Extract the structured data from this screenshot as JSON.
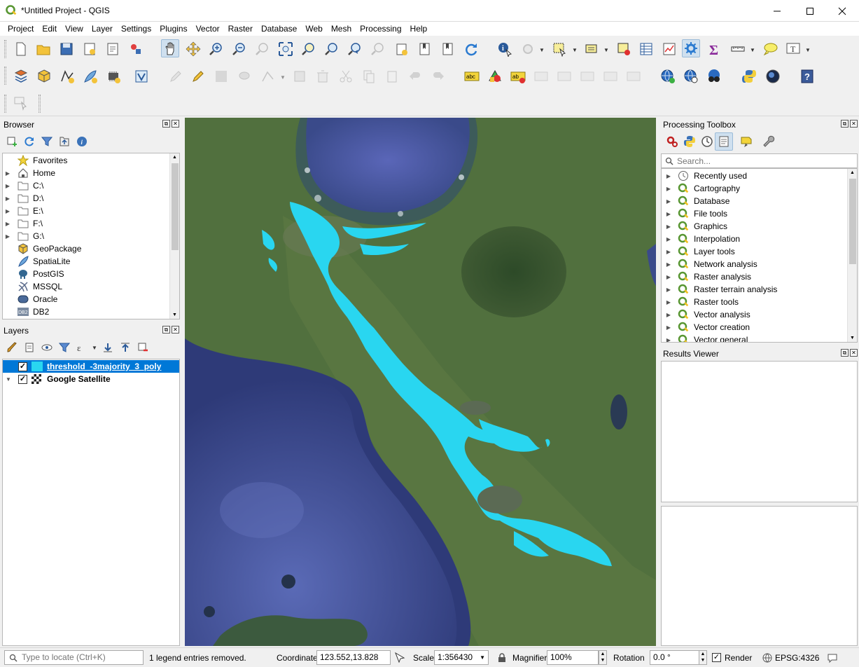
{
  "window": {
    "title": "*Untitled Project - QGIS",
    "controls": [
      "—",
      "☐",
      "✕"
    ]
  },
  "menubar": {
    "items": [
      "Project",
      "Edit",
      "View",
      "Layer",
      "Settings",
      "Plugins",
      "Vector",
      "Raster",
      "Database",
      "Web",
      "Mesh",
      "Processing",
      "Help"
    ]
  },
  "browser": {
    "title": "Browser",
    "items": [
      {
        "label": "Favorites",
        "icon": "star-icon",
        "expandable": false
      },
      {
        "label": "Home",
        "icon": "home-icon",
        "expandable": true
      },
      {
        "label": "C:\\",
        "icon": "folder-icon",
        "expandable": true
      },
      {
        "label": "D:\\",
        "icon": "folder-icon",
        "expandable": true
      },
      {
        "label": "E:\\",
        "icon": "folder-icon",
        "expandable": true
      },
      {
        "label": "F:\\",
        "icon": "folder-icon",
        "expandable": true
      },
      {
        "label": "G:\\",
        "icon": "folder-icon",
        "expandable": true
      },
      {
        "label": "GeoPackage",
        "icon": "geopackage-icon",
        "expandable": false
      },
      {
        "label": "SpatiaLite",
        "icon": "feather-icon",
        "expandable": false
      },
      {
        "label": "PostGIS",
        "icon": "elephant-icon",
        "expandable": false
      },
      {
        "label": "MSSQL",
        "icon": "mssql-icon",
        "expandable": false
      },
      {
        "label": "Oracle",
        "icon": "oracle-icon",
        "expandable": false
      },
      {
        "label": "DB2",
        "icon": "db2-icon",
        "expandable": false
      }
    ]
  },
  "layers": {
    "title": "Layers",
    "items": [
      {
        "label": "threshold_-3majority_3_poly",
        "checked": true,
        "selected": true,
        "swatch": "#29d6f0"
      },
      {
        "label": "Google Satellite",
        "checked": true,
        "selected": false
      }
    ]
  },
  "processing": {
    "title": "Processing Toolbox",
    "search_placeholder": "Search...",
    "items": [
      "Recently used",
      "Cartography",
      "Database",
      "File tools",
      "Graphics",
      "Interpolation",
      "Layer tools",
      "Network analysis",
      "Raster analysis",
      "Raster terrain analysis",
      "Raster tools",
      "Vector analysis",
      "Vector creation",
      "Vector general"
    ]
  },
  "results": {
    "title": "Results Viewer"
  },
  "statusbar": {
    "locator_placeholder": "Type to locate (Ctrl+K)",
    "message": "1 legend entries removed.",
    "coordinate_label": "Coordinate",
    "coordinate_value": "123.552,13.828",
    "scale_label": "Scale",
    "scale_value": "1:356430",
    "magnifier_label": "Magnifier",
    "magnifier_value": "100%",
    "rotation_label": "Rotation",
    "rotation_value": "0.0 °",
    "render_label": "Render",
    "crs": "EPSG:4326"
  },
  "colors": {
    "accent_selection": "#0078d7",
    "flood_overlay": "#29d6f0",
    "qgis_green": "#589632"
  }
}
